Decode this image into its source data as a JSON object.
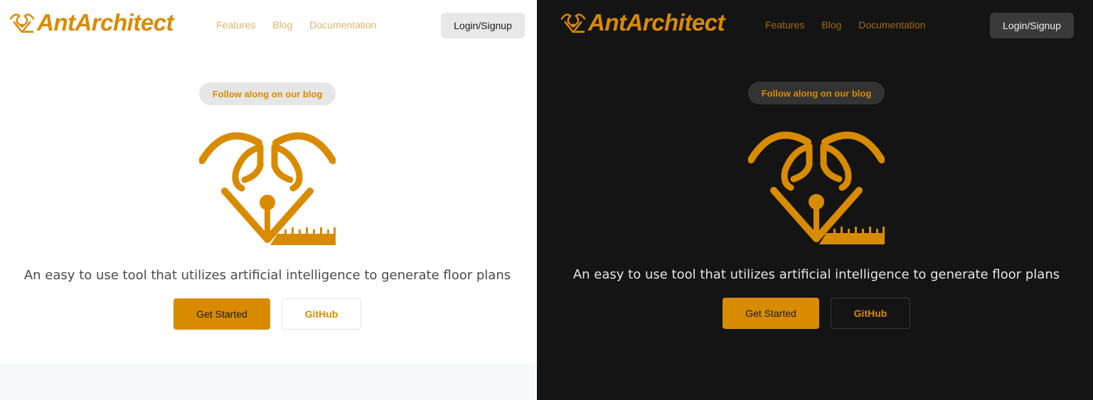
{
  "brand": {
    "name": "AntArchitect"
  },
  "nav": {
    "items": [
      "Features",
      "Blog",
      "Documentation"
    ]
  },
  "header": {
    "login_label": "Login/Signup"
  },
  "hero": {
    "blog_pill": "Follow along on our blog",
    "tagline": "An easy to use tool that utilizes artificial intelligence to generate floor plans",
    "primary_button": "Get Started",
    "secondary_button": "GitHub",
    "logo_icon": "ant-architect-logo-icon"
  },
  "colors": {
    "accent": "#d98b00",
    "light_bg": "#ffffff",
    "dark_bg": "#141414"
  },
  "themes": [
    "light",
    "dark"
  ]
}
